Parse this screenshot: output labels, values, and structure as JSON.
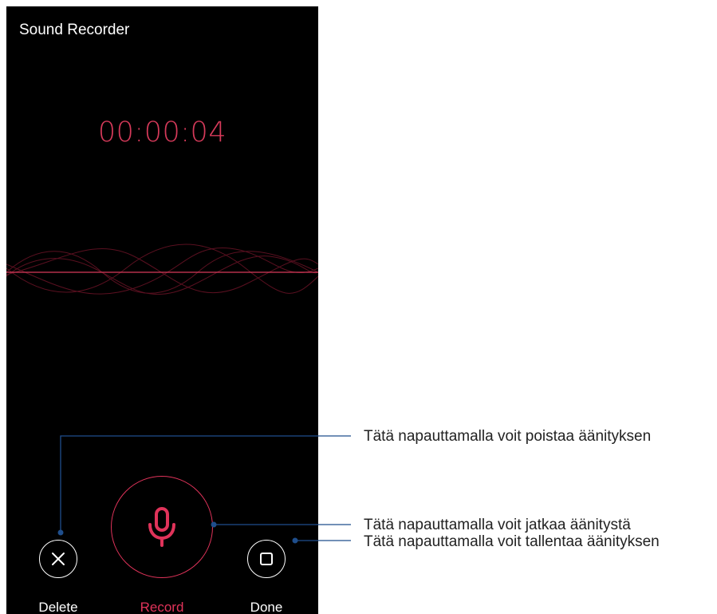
{
  "app": {
    "title": "Sound Recorder"
  },
  "recorder": {
    "elapsed_time": "00:00:04",
    "is_recording": false
  },
  "controls": {
    "delete_label": "Delete",
    "record_label": "Record",
    "done_label": "Done",
    "delete_icon": "close-icon",
    "record_icon": "microphone-icon",
    "done_icon": "stop-square-icon"
  },
  "callouts": {
    "delete": "Tätä napauttamalla voit poistaa äänityksen",
    "record": "Tätä napauttamalla voit jatkaa äänitystä",
    "done": "Tätä napauttamalla voit tallentaa äänityksen"
  },
  "colors": {
    "background": "#000000",
    "accent": "#e0335a",
    "timer": "#d63a5a",
    "callout_line": "#1f4e8c",
    "foreground": "#ffffff"
  }
}
